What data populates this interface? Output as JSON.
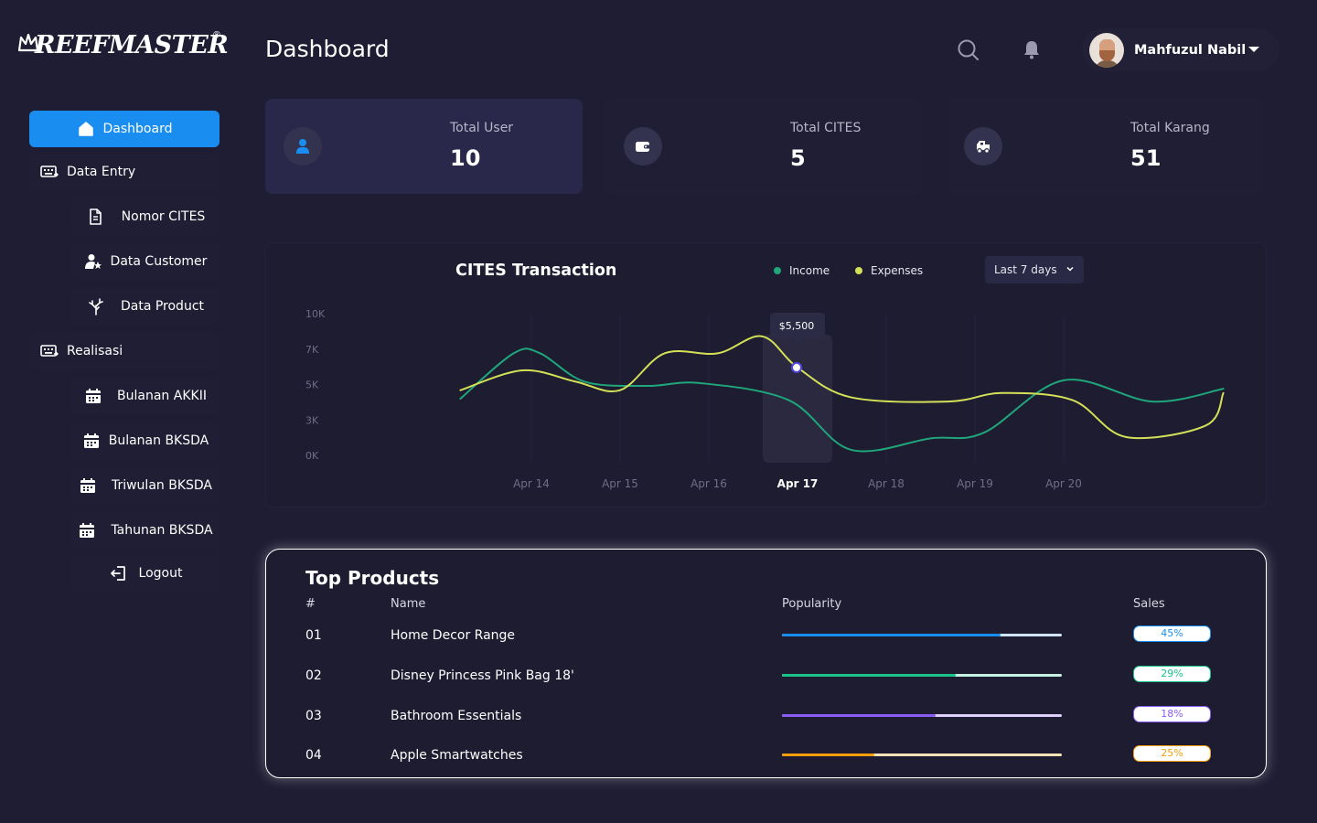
{
  "brand": {
    "logo_text": "REEFMASTER",
    "logo_mark": "®"
  },
  "header": {
    "title": "Dashboard",
    "user_name": "Mahfuzul Nabil"
  },
  "sidebar": {
    "items": [
      {
        "label": "Dashboard",
        "icon": "home-icon"
      },
      {
        "label": "Data Entry",
        "icon": "keyboard-icon"
      },
      {
        "label": "Nomor CITES",
        "icon": "document-icon"
      },
      {
        "label": "Data Customer",
        "icon": "user-star-icon"
      },
      {
        "label": "Data Product",
        "icon": "coral-icon"
      },
      {
        "label": "Realisasi",
        "icon": "keyboard-icon"
      },
      {
        "label": "Bulanan AKKII",
        "icon": "calendar-icon"
      },
      {
        "label": "Bulanan BKSDA",
        "icon": "calendar-icon"
      },
      {
        "label": "Triwulan BKSDA",
        "icon": "calendar-icon"
      },
      {
        "label": "Tahunan BKSDA",
        "icon": "calendar-icon"
      },
      {
        "label": "Logout",
        "icon": "logout-icon"
      }
    ]
  },
  "stats": [
    {
      "label": "Total User",
      "value": "10",
      "icon": "user-icon"
    },
    {
      "label": "Total CITES",
      "value": "5",
      "icon": "wallet-icon"
    },
    {
      "label": "Total Karang",
      "value": "51",
      "icon": "truck-icon"
    }
  ],
  "chart": {
    "title": "CITES Transaction",
    "legend_income": "Income",
    "legend_expenses": "Expenses",
    "range": "Last 7 days",
    "tooltip": "$5,500",
    "colors": {
      "income": "#1fa67a",
      "expenses": "#d4e157",
      "highlight": "#2a2940"
    }
  },
  "chart_data": {
    "type": "line",
    "title": "CITES Transaction",
    "x": [
      "Apr 14",
      "Apr 15",
      "Apr 16",
      "Apr 17",
      "Apr 18",
      "Apr 19",
      "Apr 20"
    ],
    "y_ticks": [
      "10K",
      "7K",
      "5K",
      "3K",
      "0K"
    ],
    "highlight_x": "Apr 17",
    "tooltip_value": "$5,500",
    "series": [
      {
        "name": "Income",
        "color": "#1fa67a",
        "points": [
          [
            13.2,
            4000
          ],
          [
            13.8,
            7200
          ],
          [
            14.1,
            7200
          ],
          [
            14.6,
            5200
          ],
          [
            15.3,
            4900
          ],
          [
            15.9,
            5100
          ],
          [
            16.9,
            3900
          ],
          [
            17.6,
            400
          ],
          [
            18.5,
            1200
          ],
          [
            19.1,
            1600
          ],
          [
            20.0,
            5300
          ],
          [
            21.0,
            3800
          ],
          [
            21.8,
            4700
          ]
        ]
      },
      {
        "name": "Expenses",
        "color": "#d4e157",
        "points": [
          [
            13.2,
            4600
          ],
          [
            13.9,
            6000
          ],
          [
            14.5,
            5200
          ],
          [
            15.0,
            4600
          ],
          [
            15.5,
            7200
          ],
          [
            16.1,
            7200
          ],
          [
            16.6,
            8400
          ],
          [
            17.0,
            6200
          ],
          [
            17.6,
            4100
          ],
          [
            18.7,
            3800
          ],
          [
            19.3,
            4400
          ],
          [
            20.1,
            3900
          ],
          [
            20.7,
            1300
          ],
          [
            21.6,
            2100
          ],
          [
            21.8,
            4400
          ]
        ]
      }
    ],
    "grid": "vertical",
    "legend": "top"
  },
  "products": {
    "title": "Top Products",
    "headers": {
      "num": "#",
      "name": "Name",
      "popularity": "Popularity",
      "sales": "Sales"
    },
    "rows": [
      {
        "num": "01",
        "name": "Home Decor Range",
        "popularity": 0.78,
        "sales": "45%",
        "color": "#1a8ef0",
        "track": "#cfe3fb"
      },
      {
        "num": "02",
        "name": "Disney Princess Pink Bag 18'",
        "popularity": 0.62,
        "sales": "29%",
        "color": "#19c38a",
        "track": "#c6f2e2"
      },
      {
        "num": "03",
        "name": "Bathroom Essentials",
        "popularity": 0.55,
        "sales": "18%",
        "color": "#8b5cf6",
        "track": "#ddd0fb"
      },
      {
        "num": "04",
        "name": "Apple Smartwatches",
        "popularity": 0.33,
        "sales": "25%",
        "color": "#f59e0b",
        "track": "#fde3b8"
      }
    ]
  }
}
